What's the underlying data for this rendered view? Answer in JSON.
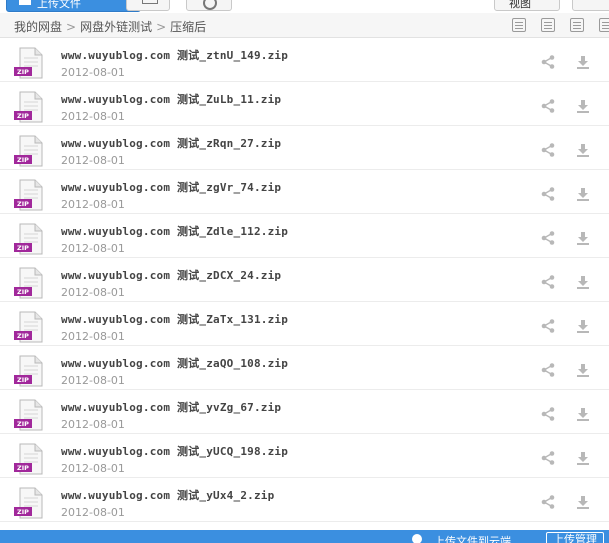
{
  "toolbar": {
    "upload_label": "上传文件",
    "right_label": "视图"
  },
  "breadcrumb": [
    "我的网盘",
    "网盘外链测试",
    "压缩后"
  ],
  "files": [
    {
      "name": "www.wuyublog.com 测试_ztnU_149.zip",
      "date": "2012-08-01"
    },
    {
      "name": "www.wuyublog.com 测试_ZuLb_11.zip",
      "date": "2012-08-01"
    },
    {
      "name": "www.wuyublog.com 测试_zRqn_27.zip",
      "date": "2012-08-01"
    },
    {
      "name": "www.wuyublog.com 测试_zgVr_74.zip",
      "date": "2012-08-01"
    },
    {
      "name": "www.wuyublog.com 测试_Zdle_112.zip",
      "date": "2012-08-01"
    },
    {
      "name": "www.wuyublog.com 测试_zDCX_24.zip",
      "date": "2012-08-01"
    },
    {
      "name": "www.wuyublog.com 测试_ZaTx_131.zip",
      "date": "2012-08-01"
    },
    {
      "name": "www.wuyublog.com 测试_zaQO_108.zip",
      "date": "2012-08-01"
    },
    {
      "name": "www.wuyublog.com 测试_yvZg_67.zip",
      "date": "2012-08-01"
    },
    {
      "name": "www.wuyublog.com 测试_yUCQ_198.zip",
      "date": "2012-08-01"
    },
    {
      "name": "www.wuyublog.com 测试_yUx4_2.zip",
      "date": "2012-08-01"
    }
  ],
  "file_type_label": "ZIP",
  "bottom": {
    "status_text": "上传文件到云端",
    "manage_label": "上传管理"
  },
  "colors": {
    "accent": "#3b8fe0",
    "zip_purple": "#a1289b",
    "icon_grey": "#b8b8b8"
  },
  "icons": {
    "share": "share-icon",
    "download": "download-icon",
    "zip": "zip-file-icon"
  }
}
